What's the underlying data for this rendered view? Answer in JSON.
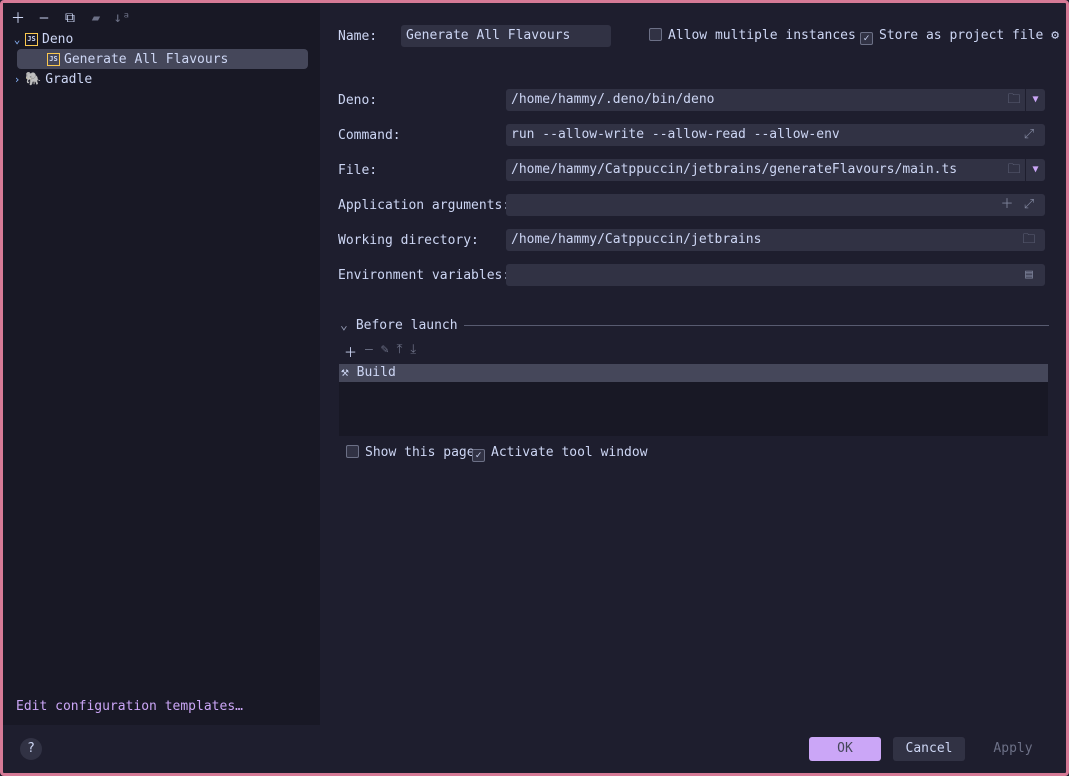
{
  "toolbar": {
    "icons": [
      "plus-icon",
      "minus-icon",
      "copy-icon",
      "new-folder-icon",
      "sort-icon"
    ]
  },
  "tree": [
    {
      "label": "Deno",
      "expanded": true
    },
    {
      "label": "Generate All Flavours",
      "selected": true
    },
    {
      "label": "Gradle",
      "expanded": false
    }
  ],
  "edit_templates": "Edit configuration templates…",
  "name": {
    "label": "Name:",
    "value": "Generate All Flavours"
  },
  "allow_multiple": {
    "label": "Allow multiple instances",
    "checked": false
  },
  "store_project": {
    "label": "Store as project file",
    "checked": true
  },
  "fields": [
    {
      "label": "Deno:",
      "value": "/home/hammy/.deno/bin/deno"
    },
    {
      "label": "Command:",
      "value": "run --allow-write --allow-read --allow-env"
    },
    {
      "label": "File:",
      "value": "/home/hammy/Catppuccin/jetbrains/generateFlavours/main.ts"
    },
    {
      "label": "Application arguments:",
      "value": ""
    },
    {
      "label": "Working directory:",
      "value": "/home/hammy/Catppuccin/jetbrains"
    },
    {
      "label": "Environment variables:",
      "value": ""
    }
  ],
  "before_launch": {
    "title": "Before launch",
    "items": [
      "Build"
    ]
  },
  "show_page": {
    "label": "Show this page",
    "checked": false
  },
  "activate_tool": {
    "label": "Activate tool window",
    "checked": true
  },
  "buttons": {
    "help": "?",
    "ok": "OK",
    "cancel": "Cancel",
    "apply": "Apply"
  },
  "colors": {
    "accent": "#cba6f7",
    "border": "#d67a96",
    "background": "#1e1e2e"
  }
}
